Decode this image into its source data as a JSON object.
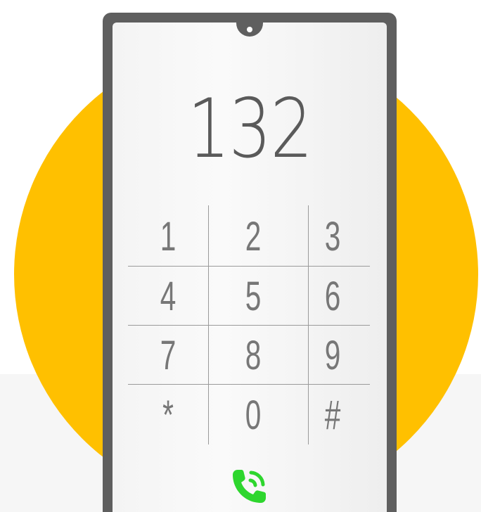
{
  "colors": {
    "accent_circle": "#ffc000",
    "phone_frame": "#5f5f5f",
    "call_green": "#2ed62e",
    "text_gray": "#777777"
  },
  "dialer": {
    "number": "132",
    "keys": [
      "1",
      "2",
      "3",
      "4",
      "5",
      "6",
      "7",
      "8",
      "9",
      "*",
      "0",
      "#"
    ],
    "call_icon": "phone-call-icon"
  }
}
